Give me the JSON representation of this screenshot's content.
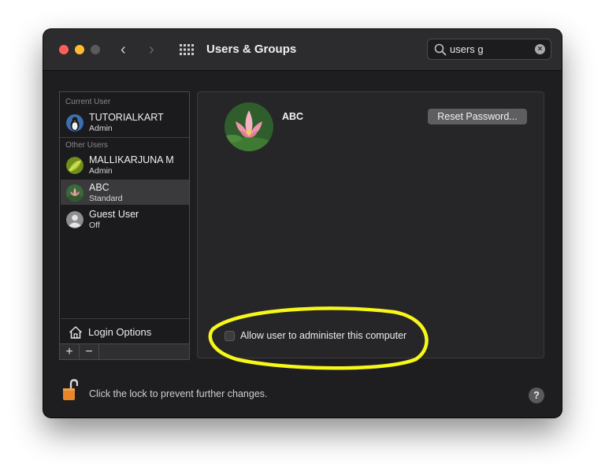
{
  "window": {
    "title": "Users & Groups",
    "search": {
      "value": "users g"
    }
  },
  "sidebar": {
    "current_user_label": "Current User",
    "other_users_label": "Other Users",
    "users": [
      {
        "name": "TUTORIALKART",
        "role": "Admin",
        "selected": false
      },
      {
        "name": "MALLIKARJUNA M",
        "role": "Admin",
        "selected": false
      },
      {
        "name": "ABC",
        "role": "Standard",
        "selected": true
      },
      {
        "name": "Guest User",
        "role": "Off",
        "selected": false
      }
    ],
    "login_options_label": "Login Options",
    "add_label": "+",
    "remove_label": "−"
  },
  "main": {
    "user_name": "ABC",
    "reset_password_label": "Reset Password...",
    "admin_checkbox_label": "Allow user to administer this computer",
    "admin_checked": false
  },
  "footer": {
    "lock_text": "Click the lock to prevent further changes.",
    "help_label": "?"
  },
  "colors": {
    "annotation": "#f7f71a",
    "lock": "#e8862a"
  }
}
